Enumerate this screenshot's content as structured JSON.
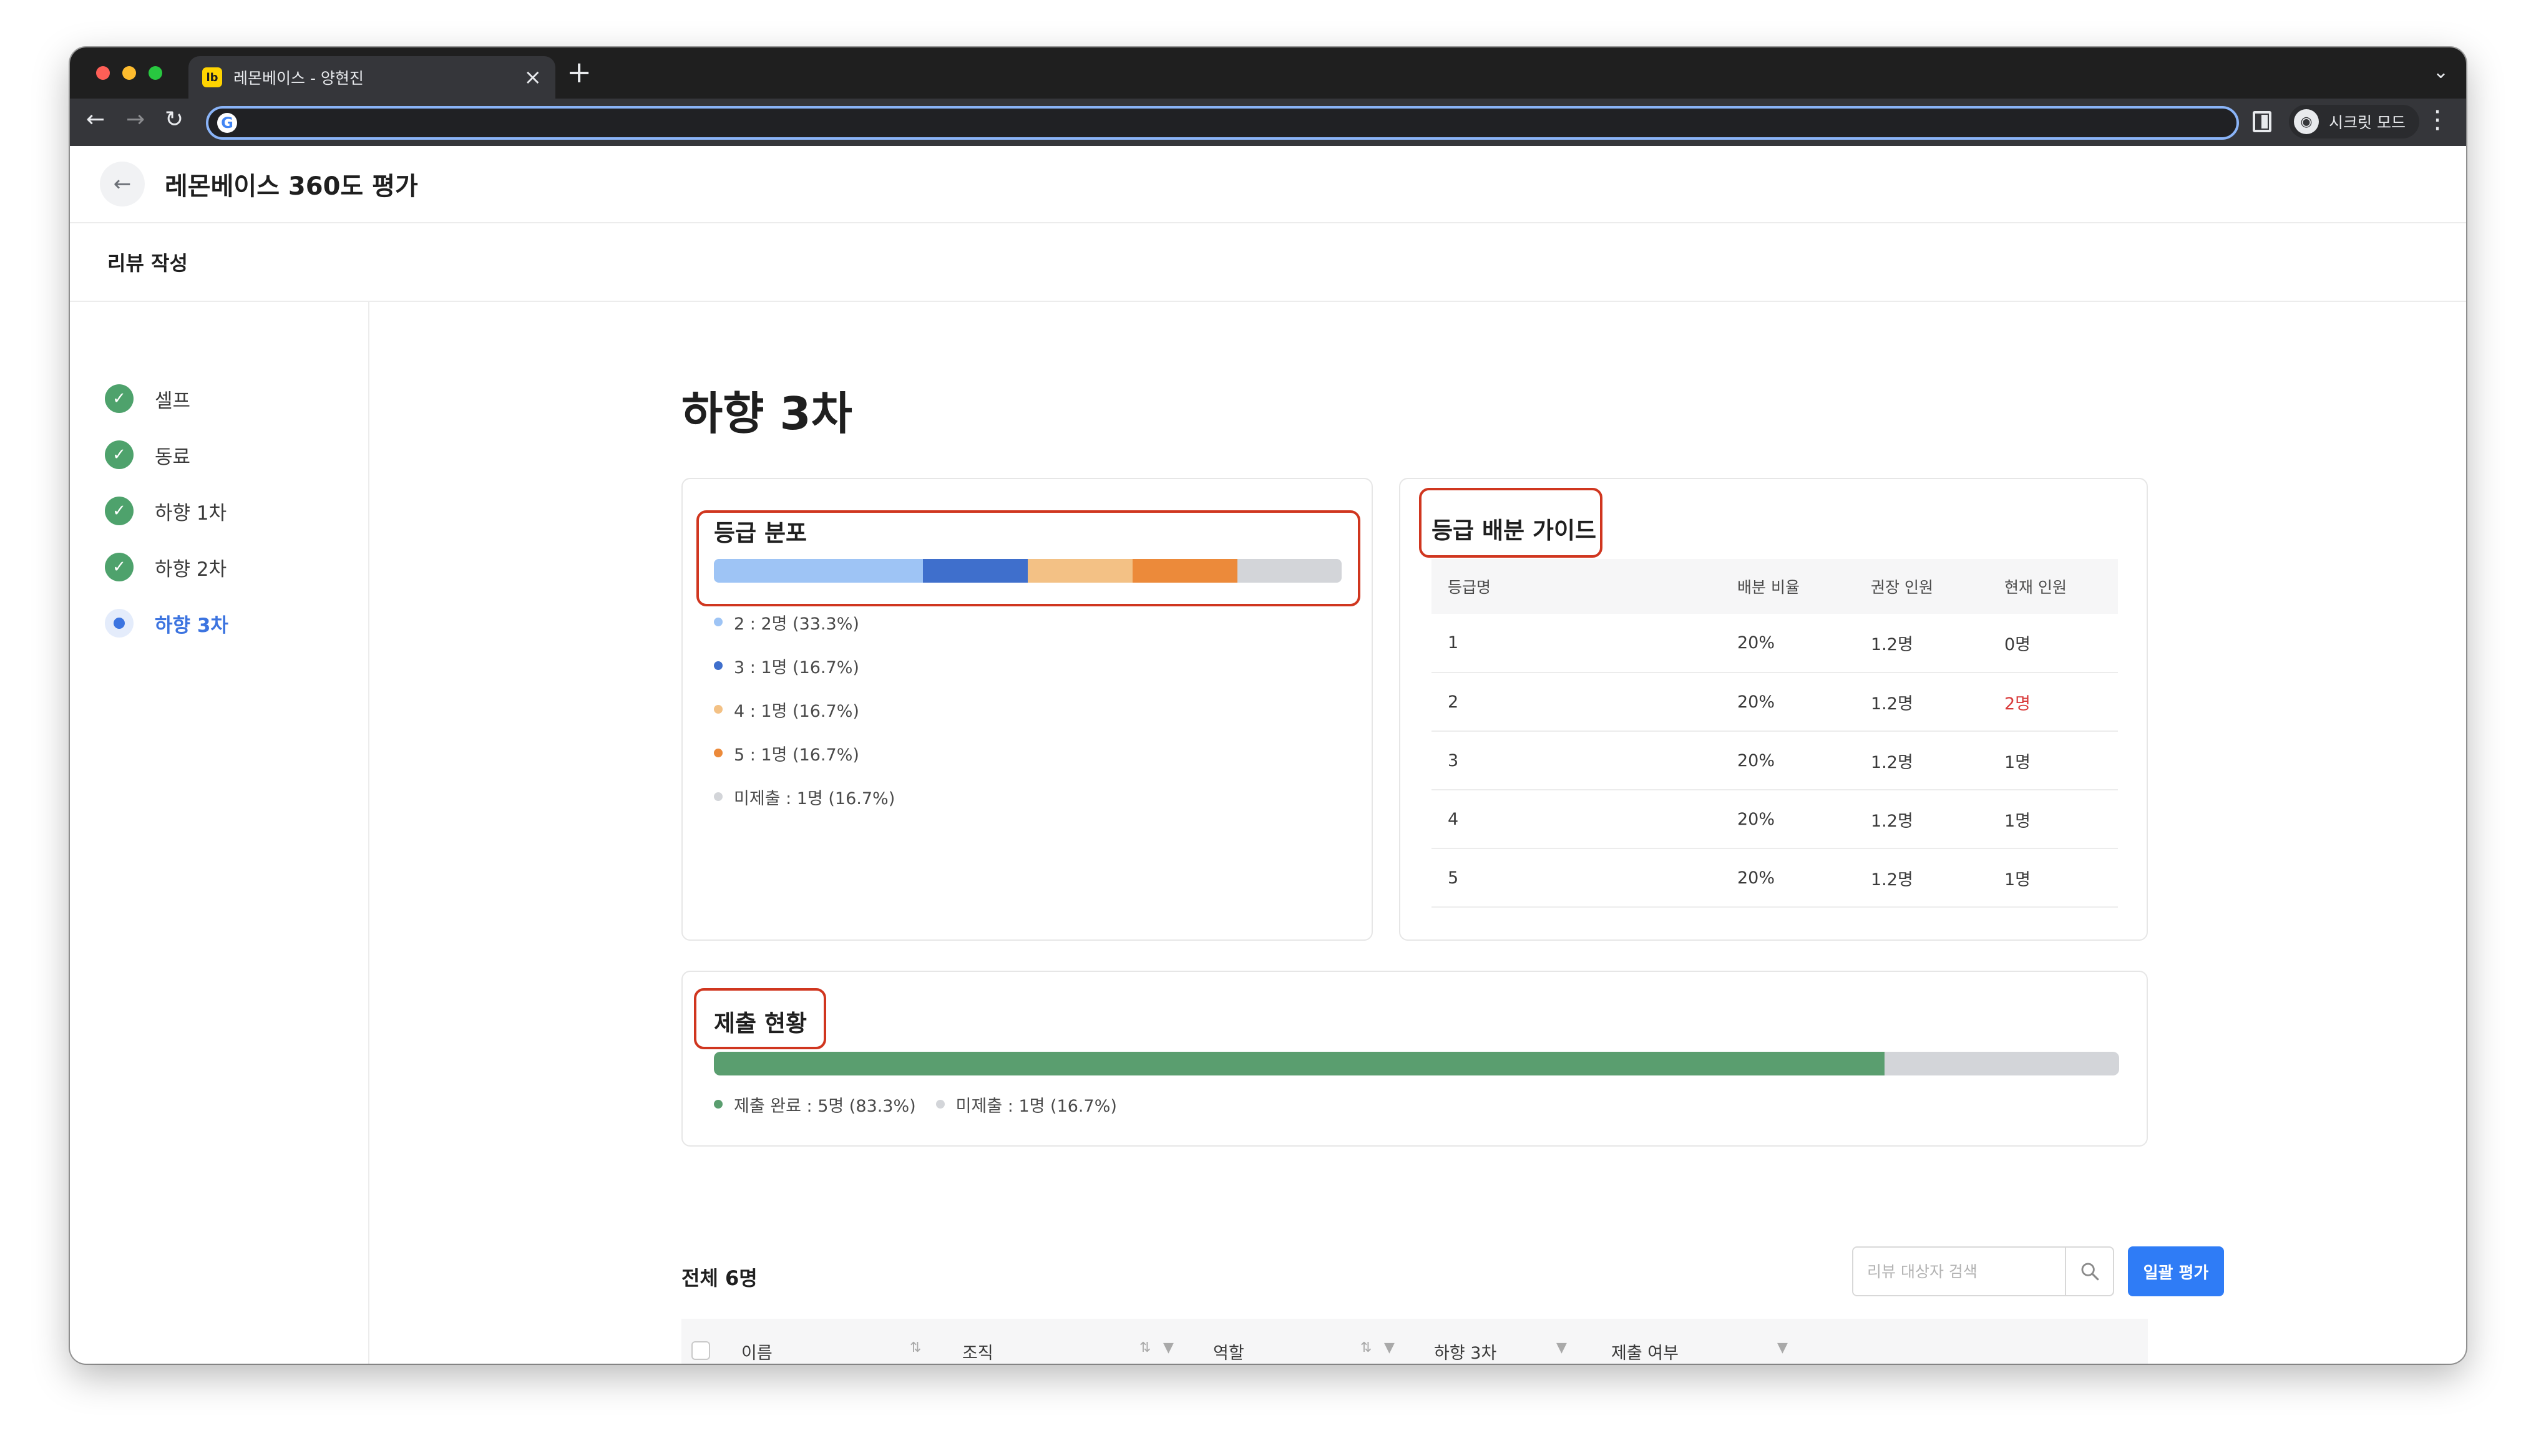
{
  "browser": {
    "tab_title": "레몬베이스 - 양현진",
    "favicon_text": "lb",
    "incognito_label": "시크릿 모드"
  },
  "app": {
    "title": "레몬베이스 360도 평가",
    "subheader": "리뷰 작성"
  },
  "sidebar": {
    "steps": [
      {
        "label": "셀프",
        "status": "done"
      },
      {
        "label": "동료",
        "status": "done"
      },
      {
        "label": "하향 1차",
        "status": "done"
      },
      {
        "label": "하향 2차",
        "status": "done"
      },
      {
        "label": "하향 3차",
        "status": "current"
      }
    ]
  },
  "page_title": "하향 3차",
  "distribution": {
    "title": "등급 분포",
    "segments": [
      {
        "label": "2 : 2명 (33.3%)",
        "fraction": 0.333,
        "color": "#9ec4f5"
      },
      {
        "label": "3 : 1명 (16.7%)",
        "fraction": 0.167,
        "color": "#3f6fcc"
      },
      {
        "label": "4 : 1명 (16.7%)",
        "fraction": 0.167,
        "color": "#f3c185"
      },
      {
        "label": "5 : 1명 (16.7%)",
        "fraction": 0.167,
        "color": "#ec8a3a"
      },
      {
        "label": "미제출 : 1명 (16.7%)",
        "fraction": 0.166,
        "color": "#d3d5d9"
      }
    ]
  },
  "guide": {
    "title": "등급 배분 가이드",
    "columns": [
      "등급명",
      "배분 비율",
      "권장 인원",
      "현재 인원"
    ],
    "rows": [
      {
        "grade": "1",
        "ratio": "20%",
        "recommended": "1.2명",
        "current": "0명"
      },
      {
        "grade": "2",
        "ratio": "20%",
        "recommended": "1.2명",
        "current": "2명"
      },
      {
        "grade": "3",
        "ratio": "20%",
        "recommended": "1.2명",
        "current": "1명"
      },
      {
        "grade": "4",
        "ratio": "20%",
        "recommended": "1.2명",
        "current": "1명"
      },
      {
        "grade": "5",
        "ratio": "20%",
        "recommended": "1.2명",
        "current": "1명"
      }
    ],
    "over_color": "#d93a3a"
  },
  "submission": {
    "title": "제출 현황",
    "completed_fraction": 0.833,
    "completed_label": "제출 완료 : 5명 (83.3%)",
    "pending_label": "미제출 : 1명 (16.7%)",
    "completed_color": "#5a9e6f",
    "pending_color": "#d3d5d9"
  },
  "list": {
    "total_label": "전체 6명",
    "search_placeholder": "리뷰 대상자 검색",
    "bulk_button": "일괄 평가",
    "columns": [
      "이름",
      "조직",
      "역할",
      "하향 3차",
      "제출 여부"
    ]
  },
  "colors": {
    "accent": "#2f7cf6",
    "done": "#4ea26c",
    "highlight": "#d0361f"
  }
}
